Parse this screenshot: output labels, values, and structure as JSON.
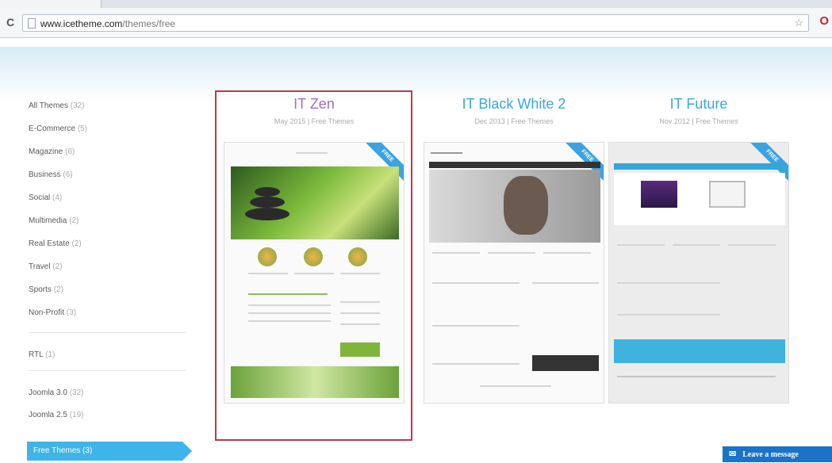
{
  "browser": {
    "url_host": "www.icetheme.com",
    "url_path": "/themes/free"
  },
  "sidebar": {
    "categories": [
      {
        "label": "All Themes",
        "count": "(32)"
      },
      {
        "label": "E-Commerce",
        "count": "(5)"
      },
      {
        "label": "Magazine",
        "count": "(6)"
      },
      {
        "label": "Business",
        "count": "(6)"
      },
      {
        "label": "Social",
        "count": "(4)"
      },
      {
        "label": "Multimedia",
        "count": "(2)"
      },
      {
        "label": "Real Estate",
        "count": "(2)"
      },
      {
        "label": "Travel",
        "count": "(2)"
      },
      {
        "label": "Sports",
        "count": "(2)"
      },
      {
        "label": "Non-Profit",
        "count": "(3)"
      }
    ],
    "rtl": {
      "label": "RTL",
      "count": "(1)"
    },
    "versions": [
      {
        "label": "Joomla 3.0",
        "count": "(32)"
      },
      {
        "label": "Joomla 2.5",
        "count": "(19)"
      }
    ],
    "active": "Free Themes (3)"
  },
  "themes": [
    {
      "title": "IT Zen",
      "meta": "May 2015  |  Free Themes",
      "ribbon": "FREE"
    },
    {
      "title": "IT Black White 2",
      "meta": "Dec 2013  |  Free Themes",
      "ribbon": "FREE"
    },
    {
      "title": "IT Future",
      "meta": "Nov 2012  |  Free Themes",
      "ribbon": "FREE"
    }
  ],
  "chat": {
    "label": "Leave a message",
    "icon": "envelope-icon"
  },
  "colors": {
    "accent": "#3fb4ea",
    "highlight": "#c0364e",
    "zen_title": "#9b6fd1"
  }
}
